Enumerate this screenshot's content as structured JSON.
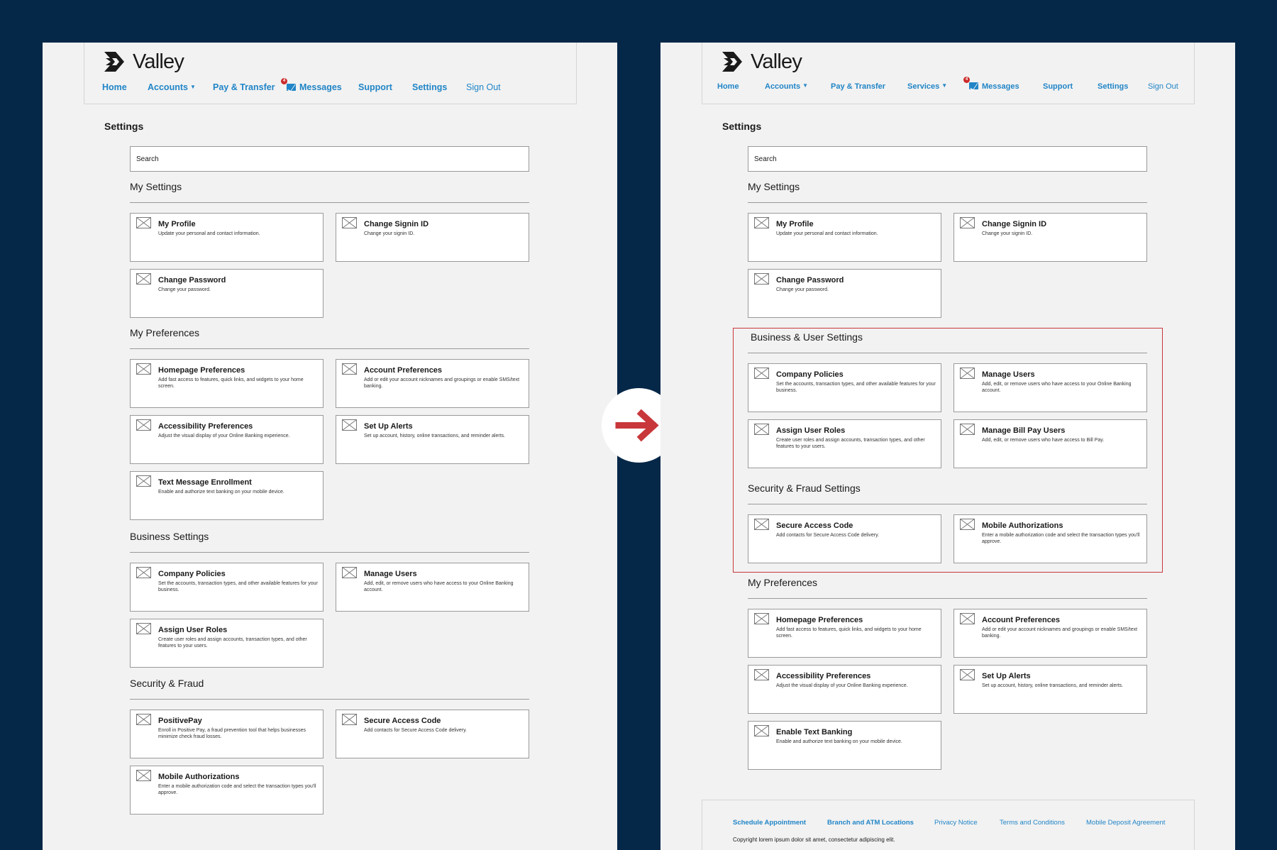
{
  "colors": {
    "background": "#052748",
    "panel": "#f2f2f2",
    "link": "#2185c7",
    "highlight": "#c8373a",
    "arrow": "#c8373a"
  },
  "left": {
    "brand": "Valley",
    "nav": {
      "home": "Home",
      "accounts": "Accounts",
      "pay_transfer": "Pay & Transfer",
      "messages": "Messages",
      "messages_badge": "4",
      "support": "Support",
      "settings": "Settings",
      "sign_out": "Sign Out"
    },
    "page_title": "Settings",
    "search_placeholder": "Search",
    "sections": {
      "my_settings": "My Settings",
      "my_preferences": "My Preferences",
      "business_settings": "Business Settings",
      "security_fraud": "Security & Fraud"
    },
    "cards": {
      "my_profile": {
        "title": "My Profile",
        "desc": "Update your personal and contact information."
      },
      "change_signin": {
        "title": "Change Signin ID",
        "desc": "Change your signin ID."
      },
      "change_password": {
        "title": "Change Password",
        "desc": "Change your password."
      },
      "homepage_prefs": {
        "title": "Homepage Preferences",
        "desc": "Add fast access to features, quick links, and widgets to your home screen."
      },
      "account_prefs": {
        "title": "Account Preferences",
        "desc": "Add or edit your account nicknames and groupings or enable SMS/text banking."
      },
      "accessibility_prefs": {
        "title": "Accessibility Preferences",
        "desc": "Adjust the visual display of your Online Banking experience."
      },
      "set_up_alerts": {
        "title": "Set Up Alerts",
        "desc": "Set up account, history, online transactions, and reminder alerts."
      },
      "text_message_enrollment": {
        "title": "Text Message Enrollment",
        "desc": "Enable and authorize text banking on your mobile device."
      },
      "company_policies": {
        "title": "Company Policies",
        "desc": "Set the accounts, transaction types, and other available features for your business."
      },
      "manage_users": {
        "title": "Manage Users",
        "desc": "Add, edit, or remove users who have access to your Online Banking account."
      },
      "assign_user_roles": {
        "title": "Assign User Roles",
        "desc": "Create user roles and assign accounts, transaction types, and other features to your users."
      },
      "positive_pay": {
        "title": "PositivePay",
        "desc": "Enroll in Positive Pay, a fraud prevention tool that helps businesses minimize check fraud losses."
      },
      "secure_access_code": {
        "title": "Secure Access Code",
        "desc": "Add contacts for Secure Access Code delivery."
      },
      "mobile_authorizations": {
        "title": "Mobile Authorizations",
        "desc": "Enter a mobile authorization code and select the transaction types you'll approve."
      }
    }
  },
  "right": {
    "brand": "Valley",
    "nav": {
      "home": "Home",
      "accounts": "Accounts",
      "pay_transfer": "Pay & Transfer",
      "services": "Services",
      "messages": "Messages",
      "messages_badge": "4",
      "support": "Support",
      "settings": "Settings",
      "sign_out": "Sign Out"
    },
    "page_title": "Settings",
    "search_placeholder": "Search",
    "sections": {
      "my_settings": "My Settings",
      "business_user_settings": "Business & User Settings",
      "security_fraud_settings": "Security & Fraud Settings",
      "my_preferences": "My Preferences"
    },
    "cards": {
      "my_profile": {
        "title": "My Profile",
        "desc": "Update your personal and contact information."
      },
      "change_signin": {
        "title": "Change Signin ID",
        "desc": "Change your signin ID."
      },
      "change_password": {
        "title": "Change Password",
        "desc": "Change your password."
      },
      "company_policies": {
        "title": "Company Policies",
        "desc": "Set the accounts, transaction types, and other available features for your business."
      },
      "manage_users": {
        "title": "Manage Users",
        "desc": "Add, edit, or remove users who have access to your Online Banking account."
      },
      "assign_user_roles": {
        "title": "Assign User Roles",
        "desc": "Create user roles and assign accounts, transaction types, and other features to your users."
      },
      "manage_bill_pay_users": {
        "title": "Manage Bill Pay Users",
        "desc": "Add, edit, or remove users who have access to Bill Pay."
      },
      "secure_access_code": {
        "title": "Secure Access Code",
        "desc": "Add contacts for Secure Access Code delivery."
      },
      "mobile_authorizations": {
        "title": "Mobile Authorizations",
        "desc": "Enter a mobile authorization code and select the transaction types you'll approve."
      },
      "homepage_prefs": {
        "title": "Homepage Preferences",
        "desc": "Add fast access to features, quick links, and widgets to your home screen."
      },
      "account_prefs": {
        "title": "Account Preferences",
        "desc": "Add or edit your account nicknames and groupings or enable SMS/text banking."
      },
      "accessibility_prefs": {
        "title": "Accessibility Preferences",
        "desc": "Adjust the visual display of your Online Banking experience."
      },
      "set_up_alerts": {
        "title": "Set Up Alerts",
        "desc": "Set up account, history, online transactions, and reminder alerts."
      },
      "enable_text_banking": {
        "title": "Enable Text Banking",
        "desc": "Enable and authorize text banking on your mobile device."
      }
    },
    "footer": {
      "schedule_appointment": "Schedule Appointment",
      "branch_atm": "Branch and ATM Locations",
      "privacy_notice": "Privacy Notice",
      "terms": "Terms and Conditions",
      "mobile_deposit": "Mobile Deposit Agreement",
      "copyright": "Copyright lorem ipsum dolor sit amet, consectetur adipiscing elit."
    }
  }
}
